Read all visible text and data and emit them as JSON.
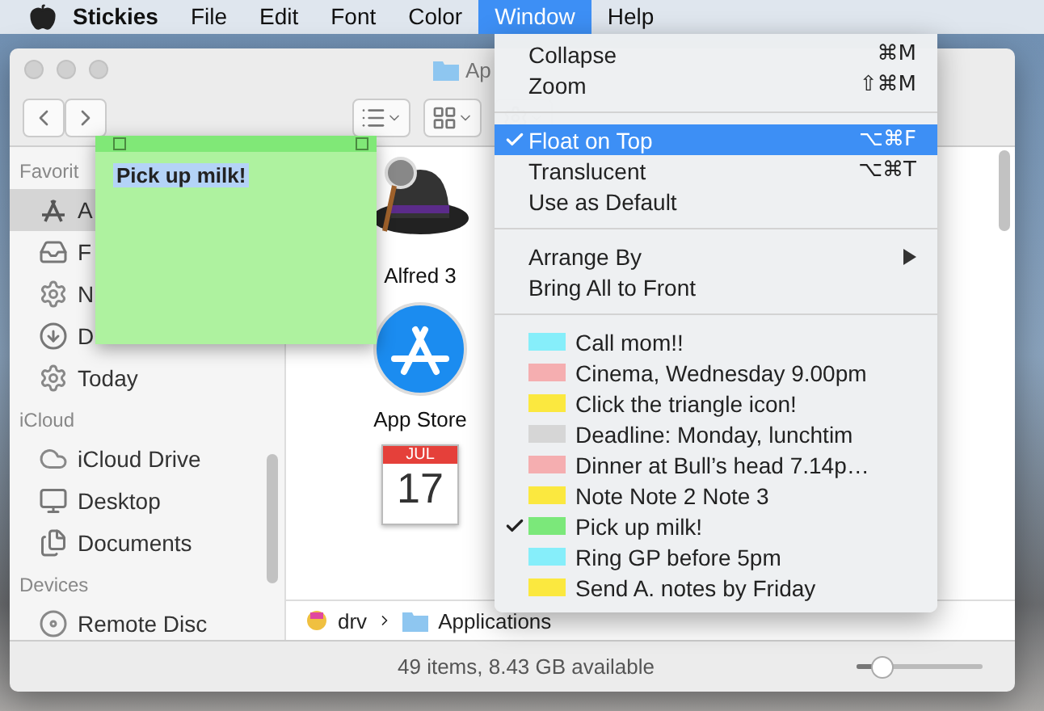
{
  "menu_bar": {
    "app": "Stickies",
    "items": [
      {
        "label": "File",
        "selected": false
      },
      {
        "label": "Edit",
        "selected": false
      },
      {
        "label": "Font",
        "selected": false
      },
      {
        "label": "Color",
        "selected": false
      },
      {
        "label": "Window",
        "selected": true
      },
      {
        "label": "Help",
        "selected": false
      }
    ]
  },
  "finder": {
    "title": "Ap",
    "sidebar": [
      {
        "heading": "Favorit",
        "items": [
          {
            "label": "A",
            "selected": true
          },
          {
            "label": "F",
            "selected": false
          },
          {
            "label": "N",
            "selected": false
          },
          {
            "label": "D",
            "selected": false
          },
          {
            "label": "Today",
            "selected": false
          }
        ]
      },
      {
        "heading": "iCloud",
        "items": [
          {
            "label": "iCloud Drive",
            "selected": false
          },
          {
            "label": "Desktop",
            "selected": false
          },
          {
            "label": "Documents",
            "selected": false
          }
        ]
      },
      {
        "heading": "Devices",
        "items": [
          {
            "label": "Remote Disc",
            "selected": false
          }
        ]
      }
    ],
    "files": [
      {
        "name": "Alfred 3",
        "kind": "hat"
      },
      {
        "name": "App Store",
        "kind": "appstore"
      },
      {
        "kind": "calendar",
        "month": "JUL",
        "day": "17"
      }
    ],
    "path": [
      "drv",
      "Applications"
    ],
    "status": "49 items, 8.43 GB available",
    "zoom_slider": {
      "level": 0.2
    }
  },
  "sticky": {
    "text": "Pick up milk!",
    "text_selected": true
  },
  "window_menu": {
    "items": [
      {
        "kind": "command",
        "label": "Collapse",
        "shortcut": "⌘M",
        "checked": false,
        "selected": false
      },
      {
        "kind": "command",
        "label": "Zoom",
        "shortcut": "⇧⌘M",
        "checked": false,
        "selected": false
      },
      {
        "kind": "separator"
      },
      {
        "kind": "command",
        "label": "Float on Top",
        "shortcut": "⌥⌘F",
        "checked": true,
        "selected": true
      },
      {
        "kind": "command",
        "label": "Translucent",
        "shortcut": "⌥⌘T",
        "checked": false,
        "selected": false
      },
      {
        "kind": "command",
        "label": "Use as Default",
        "checked": false,
        "selected": false
      },
      {
        "kind": "separator"
      },
      {
        "kind": "submenu",
        "label": "Arrange By",
        "checked": false,
        "selected": false
      },
      {
        "kind": "command",
        "label": "Bring All to Front",
        "checked": false,
        "selected": false
      },
      {
        "kind": "separator"
      }
    ],
    "notes": [
      {
        "label": "Call mom!!",
        "color": "#86eefa",
        "checked": false
      },
      {
        "label": "Cinema, Wednesday 9.00pm",
        "color": "#f5aeb0",
        "checked": false
      },
      {
        "label": "Click the triangle icon!",
        "color": "#fbe83f",
        "checked": false
      },
      {
        "label": "Deadline: Monday, lunchtim",
        "color": "#d6d6d6",
        "checked": false
      },
      {
        "label": "Dinner at Bull’s head 7.14p…",
        "color": "#f5aeb0",
        "checked": false
      },
      {
        "label": "Note  Note 2 Note 3",
        "color": "#fbe83f",
        "checked": false
      },
      {
        "label": "Pick up milk!",
        "color": "#7be87a",
        "checked": true
      },
      {
        "label": "Ring GP before 5pm",
        "color": "#86eefa",
        "checked": false
      },
      {
        "label": "Send A. notes by Friday",
        "color": "#fbe83f",
        "checked": false
      }
    ]
  }
}
